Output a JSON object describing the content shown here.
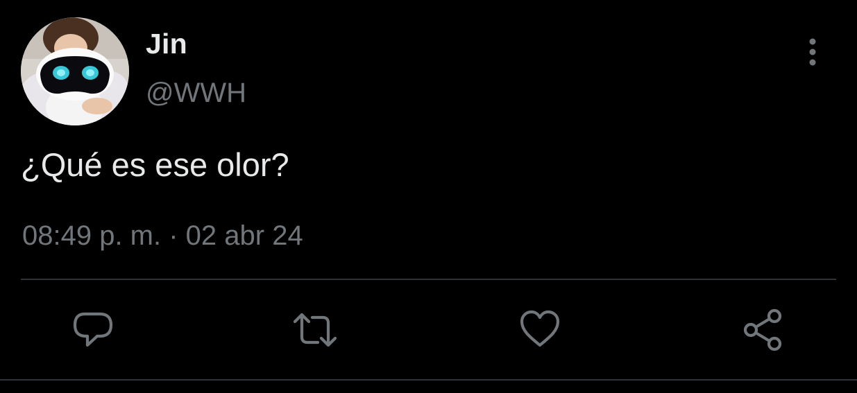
{
  "author": {
    "display_name": "Jin",
    "handle": "@WWH"
  },
  "tweet": {
    "text": "¿Qué es ese olor?",
    "timestamp": "08:49 p. m. · 02 abr 24"
  },
  "icons": {
    "more": "more-vertical-icon",
    "reply": "reply-icon",
    "retweet": "retweet-icon",
    "like": "heart-icon",
    "share": "share-icon"
  },
  "colors": {
    "background": "#000000",
    "primary_text": "#e7e9ea",
    "secondary_text": "#71767b",
    "divider": "#2f3336"
  }
}
